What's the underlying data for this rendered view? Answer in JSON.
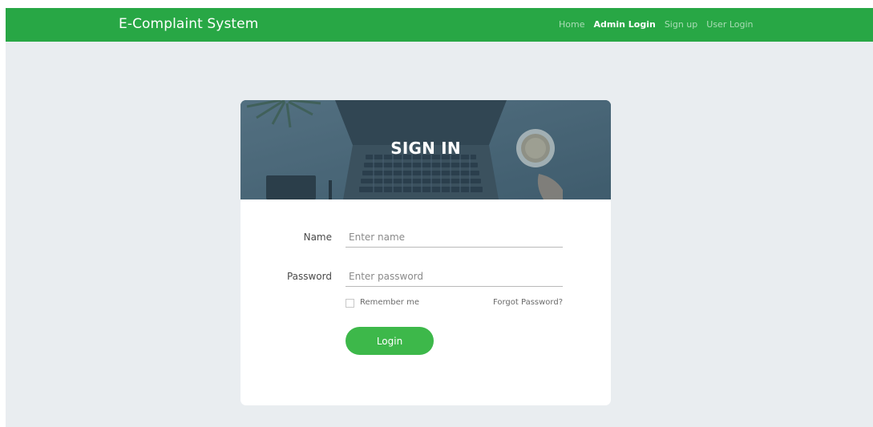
{
  "navbar": {
    "brand": "E-Complaint System",
    "links": [
      {
        "label": "Home",
        "active": false
      },
      {
        "label": "Admin Login",
        "active": true
      },
      {
        "label": "Sign up",
        "active": false
      },
      {
        "label": "User Login",
        "active": false
      }
    ]
  },
  "card": {
    "title": "SIGN IN",
    "fields": {
      "name": {
        "label": "Name",
        "placeholder": "Enter name"
      },
      "password": {
        "label": "Password",
        "placeholder": "Enter password"
      }
    },
    "remember_label": "Remember me",
    "forgot_label": "Forgot Password?",
    "login_label": "Login"
  },
  "colors": {
    "navbar_bg": "#28a745",
    "page_bg": "#e9edf0",
    "button_bg": "#3db84a"
  }
}
